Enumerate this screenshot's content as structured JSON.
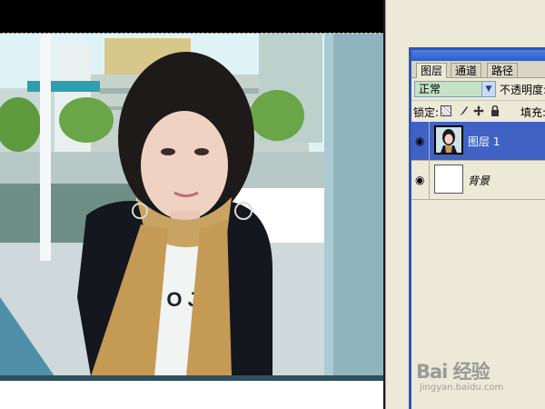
{
  "layers_panel": {
    "tabs": [
      {
        "label": "图层",
        "active": true
      },
      {
        "label": "通道",
        "active": false
      },
      {
        "label": "路径",
        "active": false
      }
    ],
    "blend_mode": "正常",
    "opacity_label": "不透明度:",
    "lock_label": "锁定:",
    "fill_label": "填充:",
    "lock_icons": [
      "lock-transparent-icon",
      "lock-brush-icon",
      "lock-move-icon",
      "lock-all-icon"
    ],
    "layers": [
      {
        "name": "图层 1",
        "selected": true,
        "visible": true,
        "thumbnail": "photo"
      },
      {
        "name": "背景",
        "selected": false,
        "visible": true,
        "thumbnail": "white"
      }
    ]
  },
  "watermark": {
    "logo": "Bai 经验",
    "url": "jingyan.baidu.com"
  },
  "colors": {
    "panel_bg": "#ece9d8",
    "panel_border": "#2f57b8",
    "selected_layer": "#3f62c4",
    "blend_field": "#c5e2c8"
  }
}
